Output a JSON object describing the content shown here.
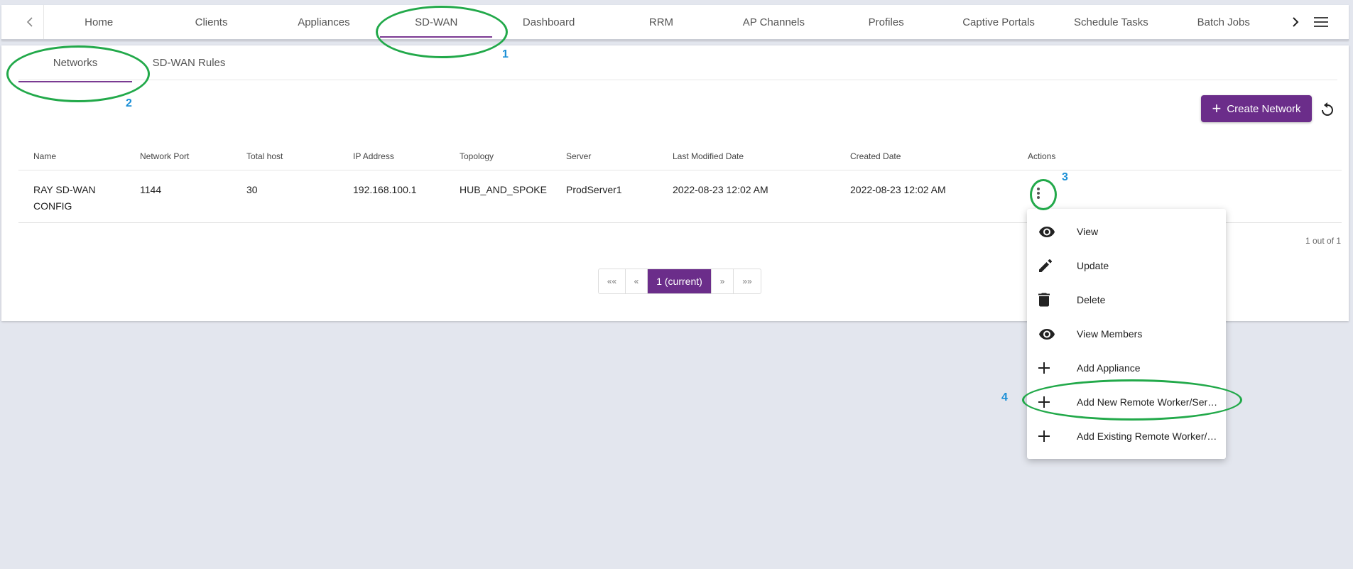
{
  "nav": {
    "tabs": [
      "Home",
      "Clients",
      "Appliances",
      "SD-WAN",
      "Dashboard",
      "RRM",
      "AP Channels",
      "Profiles",
      "Captive Portals",
      "Schedule Tasks",
      "Batch Jobs"
    ],
    "active_tab": "SD-WAN",
    "left_arrow_icon": "chevron-left-icon",
    "right_arrow_icon": "chevron-right-icon",
    "menu_icon": "hamburger-icon"
  },
  "subtabs": {
    "items": [
      "Networks",
      "SD-WAN Rules"
    ],
    "active": "Networks"
  },
  "toolbar": {
    "create_label": "Create Network",
    "refresh_icon": "refresh-icon"
  },
  "table": {
    "headers": [
      "Name",
      "Network Port",
      "Total host",
      "IP Address",
      "Topology",
      "Server",
      "Last Modified Date",
      "Created Date",
      "Actions"
    ],
    "rows": [
      {
        "name_line1": "RAY SD-WAN",
        "name_line2": "CONFIG",
        "network_port": "1144",
        "total_host": "30",
        "ip_address": "192.168.100.1",
        "topology": "HUB_AND_SPOKE",
        "server": "ProdServer1",
        "last_modified": "2022-08-23 12:02 AM",
        "created": "2022-08-23 12:02 AM"
      }
    ]
  },
  "pagination": {
    "count_text": "1 out of 1",
    "first": "««",
    "prev": "«",
    "current": "1 (current)",
    "next": "»",
    "last": "»»"
  },
  "actions_menu": {
    "items": [
      {
        "label": "View",
        "icon": "eye-icon"
      },
      {
        "label": "Update",
        "icon": "pencil-icon"
      },
      {
        "label": "Delete",
        "icon": "trash-icon"
      },
      {
        "label": "View Members",
        "icon": "eye-icon"
      },
      {
        "label": "Add Appliance",
        "icon": "plus-icon"
      },
      {
        "label": "Add New Remote Worker/Server",
        "icon": "plus-icon"
      },
      {
        "label": "Add Existing Remote Worker/Server",
        "icon": "plus-icon"
      }
    ]
  },
  "annotations": {
    "n1": "1",
    "n2": "2",
    "n3": "3",
    "n4": "4"
  },
  "colors": {
    "accent": "#6b2d8a",
    "annotation_ring": "#22a94a",
    "annotation_number": "#1b8fd6"
  }
}
